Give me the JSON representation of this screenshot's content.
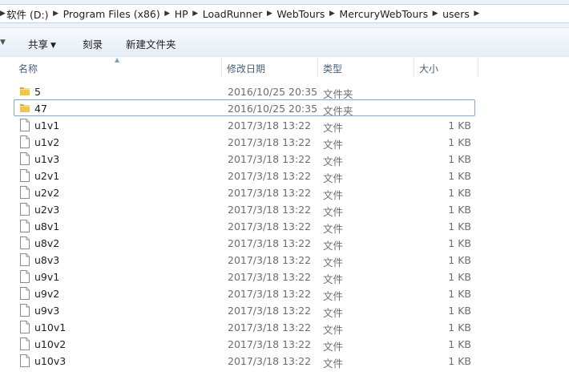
{
  "address": {
    "crumbs": [
      "软件 (D:)",
      "Program Files (x86)",
      "HP",
      "LoadRunner",
      "WebTours",
      "MercuryWebTours",
      "users"
    ]
  },
  "toolbar": {
    "share_label": "共享",
    "burn_label": "刻录",
    "new_folder_label": "新建文件夹"
  },
  "columns": {
    "name": "名称",
    "modified": "修改日期",
    "type": "类型",
    "size": "大小"
  },
  "files": [
    {
      "name": "5",
      "modified": "2016/10/25 20:35",
      "type": "文件夹",
      "size": "",
      "icon": "folder-icon"
    },
    {
      "name": "47",
      "modified": "2016/10/25 20:35",
      "type": "文件夹",
      "size": "",
      "icon": "folder-icon"
    },
    {
      "name": "u1v1",
      "modified": "2017/3/18 13:22",
      "type": "文件",
      "size": "1 KB",
      "icon": "file-icon"
    },
    {
      "name": "u1v2",
      "modified": "2017/3/18 13:22",
      "type": "文件",
      "size": "1 KB",
      "icon": "file-icon"
    },
    {
      "name": "u1v3",
      "modified": "2017/3/18 13:22",
      "type": "文件",
      "size": "1 KB",
      "icon": "file-icon"
    },
    {
      "name": "u2v1",
      "modified": "2017/3/18 13:22",
      "type": "文件",
      "size": "1 KB",
      "icon": "file-icon"
    },
    {
      "name": "u2v2",
      "modified": "2017/3/18 13:22",
      "type": "文件",
      "size": "1 KB",
      "icon": "file-icon"
    },
    {
      "name": "u2v3",
      "modified": "2017/3/18 13:22",
      "type": "文件",
      "size": "1 KB",
      "icon": "file-icon"
    },
    {
      "name": "u8v1",
      "modified": "2017/3/18 13:22",
      "type": "文件",
      "size": "1 KB",
      "icon": "file-icon"
    },
    {
      "name": "u8v2",
      "modified": "2017/3/18 13:22",
      "type": "文件",
      "size": "1 KB",
      "icon": "file-icon"
    },
    {
      "name": "u8v3",
      "modified": "2017/3/18 13:22",
      "type": "文件",
      "size": "1 KB",
      "icon": "file-icon"
    },
    {
      "name": "u9v1",
      "modified": "2017/3/18 13:22",
      "type": "文件",
      "size": "1 KB",
      "icon": "file-icon"
    },
    {
      "name": "u9v2",
      "modified": "2017/3/18 13:22",
      "type": "文件",
      "size": "1 KB",
      "icon": "file-icon"
    },
    {
      "name": "u9v3",
      "modified": "2017/3/18 13:22",
      "type": "文件",
      "size": "1 KB",
      "icon": "file-icon"
    },
    {
      "name": "u10v1",
      "modified": "2017/3/18 13:22",
      "type": "文件",
      "size": "1 KB",
      "icon": "file-icon"
    },
    {
      "name": "u10v2",
      "modified": "2017/3/18 13:22",
      "type": "文件",
      "size": "1 KB",
      "icon": "file-icon"
    },
    {
      "name": "u10v3",
      "modified": "2017/3/18 13:22",
      "type": "文件",
      "size": "1 KB",
      "icon": "file-icon"
    }
  ],
  "focused_row": 1,
  "colors": {
    "folder": "#e8b93a",
    "focus_border": "#8aa4c2",
    "secondary_text": "#6d6d6d"
  }
}
